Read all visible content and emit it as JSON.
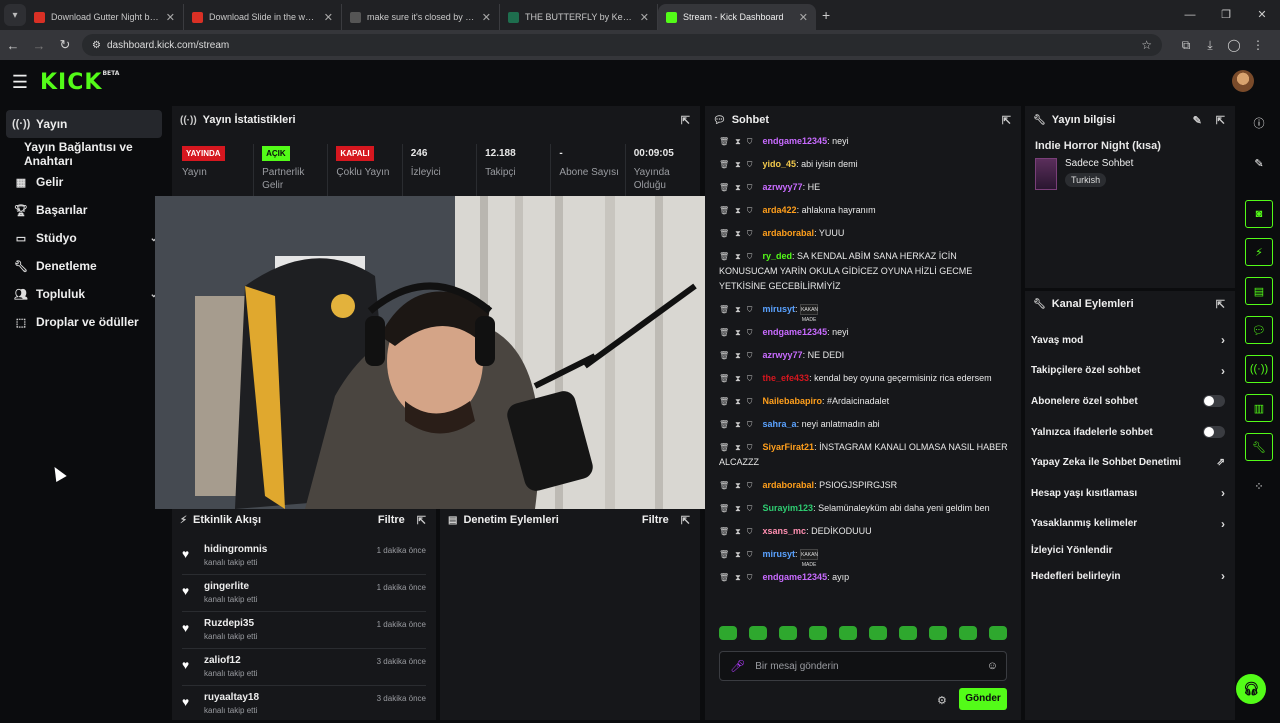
{
  "browser": {
    "tabs": [
      {
        "title": "Download Gutter Night by Wa",
        "fav": "#d93025"
      },
      {
        "title": "Download Slide in the woods b",
        "fav": "#d93025"
      },
      {
        "title": "make sure it's closed by corpse",
        "fav": "#555555"
      },
      {
        "title": "THE BUTTERFLY by Kerineia",
        "fav": "#1e6e4e"
      },
      {
        "title": "Stream - Kick Dashboard",
        "fav": "#53fc18"
      }
    ],
    "url": "dashboard.kick.com/stream"
  },
  "header": {
    "logo": "KICK",
    "beta": "BETA"
  },
  "sidebar": {
    "items": [
      {
        "label": "Yayın",
        "icon": "broadcast-icon"
      },
      {
        "label": "Yayın Bağlantısı ve Anahtarı"
      },
      {
        "label": "Gelir",
        "icon": "chart-icon"
      },
      {
        "label": "Başarılar",
        "icon": "trophy-icon"
      },
      {
        "label": "Stüdyo",
        "icon": "studio-icon"
      },
      {
        "label": "Denetleme",
        "icon": "wrench-icon"
      },
      {
        "label": "Topluluk",
        "icon": "users-icon"
      },
      {
        "label": "Droplar ve ödüller",
        "icon": "gift-icon"
      }
    ]
  },
  "stats_panel": {
    "title": "Yayın İstatistikleri",
    "stats": [
      {
        "badge": "YAYINDA",
        "label": "Yayın"
      },
      {
        "badge": "AÇIK",
        "label": "Partnerlik Gelir"
      },
      {
        "badge": "KAPALI",
        "label": "Çoklu Yayın"
      },
      {
        "value": "246",
        "label": "İzleyici"
      },
      {
        "value": "12.188",
        "label": "Takipçi"
      },
      {
        "value": "-",
        "label": "Abone Sayısı"
      },
      {
        "value": "00:09:05",
        "label": "Yayında Olduğu"
      }
    ]
  },
  "events_panel": {
    "title": "Etkinlik Akışı",
    "filter": "Filtre",
    "events": [
      {
        "user": "hidingromnis",
        "action": "kanalı takip etti",
        "time": "1 dakika önce"
      },
      {
        "user": "gingerlite",
        "action": "kanalı takip etti",
        "time": "1 dakika önce"
      },
      {
        "user": "Ruzdepi35",
        "action": "kanalı takip etti",
        "time": "1 dakika önce"
      },
      {
        "user": "zaliof12",
        "action": "kanalı takip etti",
        "time": "3 dakika önce"
      },
      {
        "user": "ruyaaltay18",
        "action": "kanalı takip etti",
        "time": "3 dakika önce"
      }
    ]
  },
  "mod_panel": {
    "title": "Denetim Eylemleri",
    "filter": "Filtre"
  },
  "chat": {
    "title": "Sohbet",
    "messages": [
      {
        "user": "endgame12345",
        "color": "#c86bff",
        "text": ": neyi"
      },
      {
        "user": "yido_45",
        "color": "#f2c94c",
        "text": ": abi iyisin demi"
      },
      {
        "user": "azrwyy77",
        "color": "#c86bff",
        "text": ": HE"
      },
      {
        "user": "arda422",
        "color": "#ff9f1c",
        "text": ": ahlakına hayranım"
      },
      {
        "user": "ardaborabal",
        "color": "#ff9f1c",
        "text": ": YUUU"
      },
      {
        "user": "ry_ded",
        "color": "#53fc18",
        "text": ": SA KENDAL ABİM SANA HERKAZ İCİN KONUSUCAM YARİN OKULA GİDİCEZ OYUNA HİZLİ GECME YETKİSİNE GECEBİLİRMİYİZ"
      },
      {
        "user": "mirusyt",
        "color": "#5aa2ff",
        "text": ": ",
        "emote": "KAKAN MADE"
      },
      {
        "user": "endgame12345",
        "color": "#c86bff",
        "text": ": neyi"
      },
      {
        "user": "azrwyy77",
        "color": "#c86bff",
        "text": ": NE DEDI"
      },
      {
        "user": "the_efe433",
        "color": "#d6171f",
        "text": ": kendal bey oyuna geçermisiniz rica edersem"
      },
      {
        "user": "Nailebabapiro",
        "color": "#ff9f1c",
        "text": ": #Ardaicinadalet"
      },
      {
        "user": "sahra_a",
        "color": "#5aa2ff",
        "text": ": neyi anlatmadın abi"
      },
      {
        "user": "SiyarFirat21",
        "color": "#ff9f1c",
        "text": ": İNSTAGRAM KANALI OLMASA NASIL HABER ALCAZZZ"
      },
      {
        "user": "ardaborabal",
        "color": "#ff9f1c",
        "text": ": PSIOGJSPIRGJSR"
      },
      {
        "user": "Surayim123",
        "color": "#2ecc71",
        "text": ": Selamünaleyküm abi daha yeni geldim ben"
      },
      {
        "user": "xsans_mc",
        "color": "#ff8fb1",
        "text": ": DEDİKODUUU"
      },
      {
        "user": "mirusyt",
        "color": "#5aa2ff",
        "text": ": ",
        "emote": "KAKAN MADE"
      },
      {
        "user": "endgame12345",
        "color": "#c86bff",
        "text": ": ayıp"
      }
    ],
    "placeholder": "Bir mesaj gönderin",
    "send": "Gönder"
  },
  "stream_info": {
    "title": "Yayın bilgisi",
    "stream_title": "Indie Horror Night (kısa)",
    "category": "Sadece Sohbet",
    "tag": "Turkish"
  },
  "channel_actions": {
    "title": "Kanal Eylemleri",
    "items": [
      {
        "label": "Yavaş mod",
        "kind": "chevron"
      },
      {
        "label": "Takipçilere özel sohbet",
        "kind": "chevron"
      },
      {
        "label": "Abonelere özel sohbet",
        "kind": "toggle"
      },
      {
        "label": "Yalnızca ifadelerle sohbet",
        "kind": "toggle"
      },
      {
        "label": "Yapay Zeka ile Sohbet Denetimi",
        "kind": "external"
      },
      {
        "label": "Hesap yaşı kısıtlaması",
        "kind": "chevron"
      },
      {
        "label": "Yasaklanmış kelimeler",
        "kind": "chevron"
      },
      {
        "label": "İzleyici Yönlendir",
        "kind": "none"
      },
      {
        "label": "Hedefleri belirleyin",
        "kind": "chevron"
      }
    ]
  }
}
